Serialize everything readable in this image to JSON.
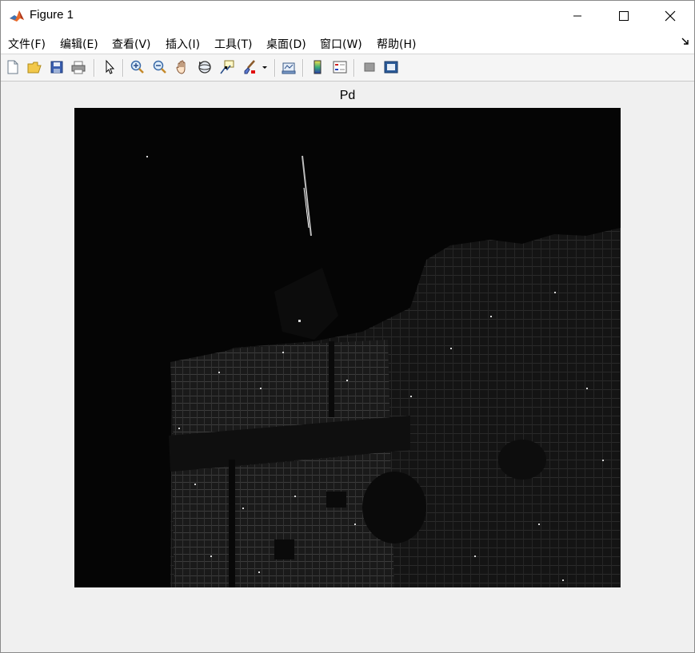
{
  "window": {
    "title": "Figure 1",
    "controls": {
      "minimize": "minimize",
      "maximize": "maximize",
      "close": "close"
    }
  },
  "menu": {
    "items": [
      {
        "label": "文件(F)",
        "name": "menu-file"
      },
      {
        "label": "编辑(E)",
        "name": "menu-edit"
      },
      {
        "label": "查看(V)",
        "name": "menu-view"
      },
      {
        "label": "插入(I)",
        "name": "menu-insert"
      },
      {
        "label": "工具(T)",
        "name": "menu-tools"
      },
      {
        "label": "桌面(D)",
        "name": "menu-desktop"
      },
      {
        "label": "窗口(W)",
        "name": "menu-window"
      },
      {
        "label": "帮助(H)",
        "name": "menu-help"
      }
    ]
  },
  "toolbar": {
    "icons": [
      "new-figure-icon",
      "open-file-icon",
      "save-icon",
      "print-icon",
      "edit-plot-arrow-icon",
      "zoom-in-icon",
      "zoom-out-icon",
      "pan-hand-icon",
      "rotate-3d-icon",
      "data-cursor-icon",
      "brush-icon",
      "link-plot-icon",
      "insert-colorbar-icon",
      "insert-legend-icon",
      "hide-plot-tools-icon",
      "show-plot-tools-icon"
    ]
  },
  "figure": {
    "title": "Pd",
    "image_description_colors": {
      "background": "#000000",
      "foreground_max": "#ffffff"
    }
  }
}
